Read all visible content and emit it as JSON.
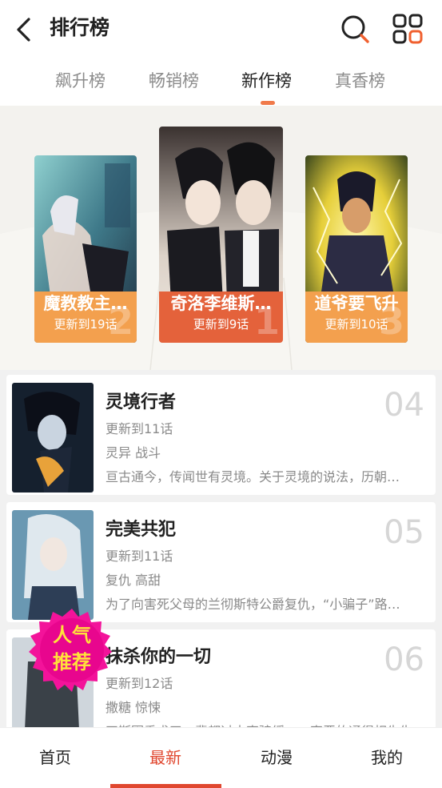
{
  "header": {
    "title": "排行榜",
    "back_icon": "back-arrow-icon",
    "search_icon": "search-icon",
    "menu_icon": "grid-menu-icon"
  },
  "tabs": [
    {
      "label": "飙升榜",
      "active": false
    },
    {
      "label": "畅销榜",
      "active": false
    },
    {
      "label": "新作榜",
      "active": true
    },
    {
      "label": "真香榜",
      "active": false
    }
  ],
  "top3": [
    {
      "rank": "1",
      "title": "奇洛李维斯…",
      "update": "更新到9话",
      "color": "#e4623b"
    },
    {
      "rank": "2",
      "title": "魔教教主…",
      "update": "更新到19话",
      "color": "#f3a04e"
    },
    {
      "rank": "3",
      "title": "道爷要飞升",
      "update": "更新到10话",
      "color": "#f3a04e"
    }
  ],
  "list": [
    {
      "rank": "04",
      "title": "灵境行者",
      "update": "更新到11话",
      "tags": "灵异 战斗",
      "desc": "亘古通今，传闻世有灵境。关于灵境的说法，历朝…"
    },
    {
      "rank": "05",
      "title": "完美共犯",
      "update": "更新到11话",
      "tags": "复仇 高甜",
      "desc": "为了向害死父母的兰彻斯特公爵复仇，“小骗子”路…"
    },
    {
      "rank": "06",
      "title": "抹杀你的一切",
      "update": "更新到12话",
      "tags": "撒糖 惊悚",
      "desc": "四斯圈重求了一辈都过去直骗缓，一直恶的通得相先生…"
    }
  ],
  "badge": {
    "line1": "人气",
    "line2": "推荐"
  },
  "bottom_nav": [
    {
      "label": "首页",
      "active": false
    },
    {
      "label": "最新",
      "active": true
    },
    {
      "label": "动漫",
      "active": false
    },
    {
      "label": "我的",
      "active": false
    }
  ],
  "colors": {
    "accent": "#e0472f",
    "tab_indicator": "#f07a4a",
    "first_label": "#e4623b",
    "other_label": "#f3a04e"
  }
}
